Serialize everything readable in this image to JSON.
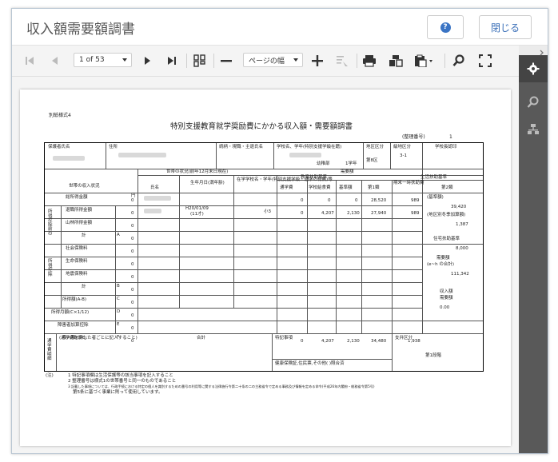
{
  "window": {
    "title": "収入額需要額調書",
    "help_icon": "?",
    "close_label": "閉じる"
  },
  "toolbar": {
    "page_select": "1 of 53",
    "zoom_select": "ページの幅"
  },
  "document": {
    "form_id": "別紙様式4",
    "title": "特別支援教育就学奨励費にかかる収入額・需要額調書",
    "serial_label": "(整理番号)",
    "serial_value": "1",
    "head": {
      "guardian": "保護者氏名",
      "address": "住所",
      "relation": "続柄・現職・主退氏名",
      "school": "学校名、学年(特別支援学級在籍)",
      "region": "地区区分",
      "grade_class": "級地区分",
      "principal": "学校長認印",
      "school_value": "幼稚部",
      "year_value": "1学年",
      "region_value": "第8区",
      "grade_value": "3-1"
    },
    "sections": {
      "income_status": "世帯の収入状況",
      "household": "世帯の状況(前年12月末日現在)",
      "demand": "需要額",
      "aid_standard": "教育扶助基準",
      "living_standard": "生活扶助基準",
      "name": "氏名",
      "birth": "生年月日(満年齢)",
      "school_grade": "在学学校名・学年(特別支援学級・通学の有無)等",
      "commute": "通学費",
      "lunch": "学校給食費",
      "base": "基準額",
      "first": "第1類",
      "seasonal": "期末一時扶助費",
      "second": "第2類"
    },
    "rows": {
      "pre_tax": "所得控除前の",
      "total_income": "総所得金額",
      "retirement": "退職所得金額",
      "forest": "山林所得金額",
      "sum": "計",
      "deduction": "所得控除",
      "social": "社会保険料",
      "life": "生命保険料",
      "quake": "地震保険料",
      "income_ab": "所得額(A-B)",
      "monthly": "所得月額(C×1/12)",
      "disability": "障害者加算控除",
      "income_de": "収入額(D-E)",
      "commute_note": "通学費明細",
      "commute_instr": "(通学費を要した者ごとに記入すること)",
      "special": "特記事項",
      "support": "支弁区分",
      "grade1": "第1段階",
      "insurance_note": "健康保険証,住民票,その他(  )照合済",
      "note_head": "(注)"
    },
    "letters": {
      "a": "A",
      "b": "B",
      "c": "C",
      "d": "D",
      "e": "E",
      "f": "F"
    },
    "values": {
      "yen": "円",
      "zero": "0",
      "birth_date": "H20/01/09",
      "birth_age": "(11才)",
      "school_kind": "小3",
      "r1_base": "28,520",
      "r1_seasonal": "989",
      "r2_lunch": "4,207",
      "r2_base": "2,130",
      "r2_first": "27,940",
      "r2_seasonal": "989",
      "second_total": "39,420",
      "second_label": "(基準額)",
      "region_add_label": "(地区別冬季加算額)",
      "region_add": "1,387",
      "housing_label": "住宅扶助基準",
      "housing": "8,000",
      "demand_label": "需要額",
      "demand_sub": "(e~h の合計)",
      "demand_total": "111,342",
      "ratio_label": "収入額",
      "ratio_sub": "需要額",
      "ratio": "0.00",
      "total_label": "合計",
      "tot_lunch": "4,207",
      "tot_base": "2,130",
      "tot_first": "34,480",
      "tot_seasonal": "1,938",
      "mark": "※"
    },
    "notes": [
      "1 特記事項欄は生活保護等の該当事項を記入すること",
      "2 整理番号は様式1の世帯番号と同一のものであること",
      "3 記載した事項については、行政手続における特定の個人を識別するための番号の利用等に関する法律施行令第二十条の二の主務省令で定める事務及び情報を定める命令(平成26年内閣府・総務省令第5号)",
      "第5条に基づく事業に則って使用しています。"
    ]
  }
}
